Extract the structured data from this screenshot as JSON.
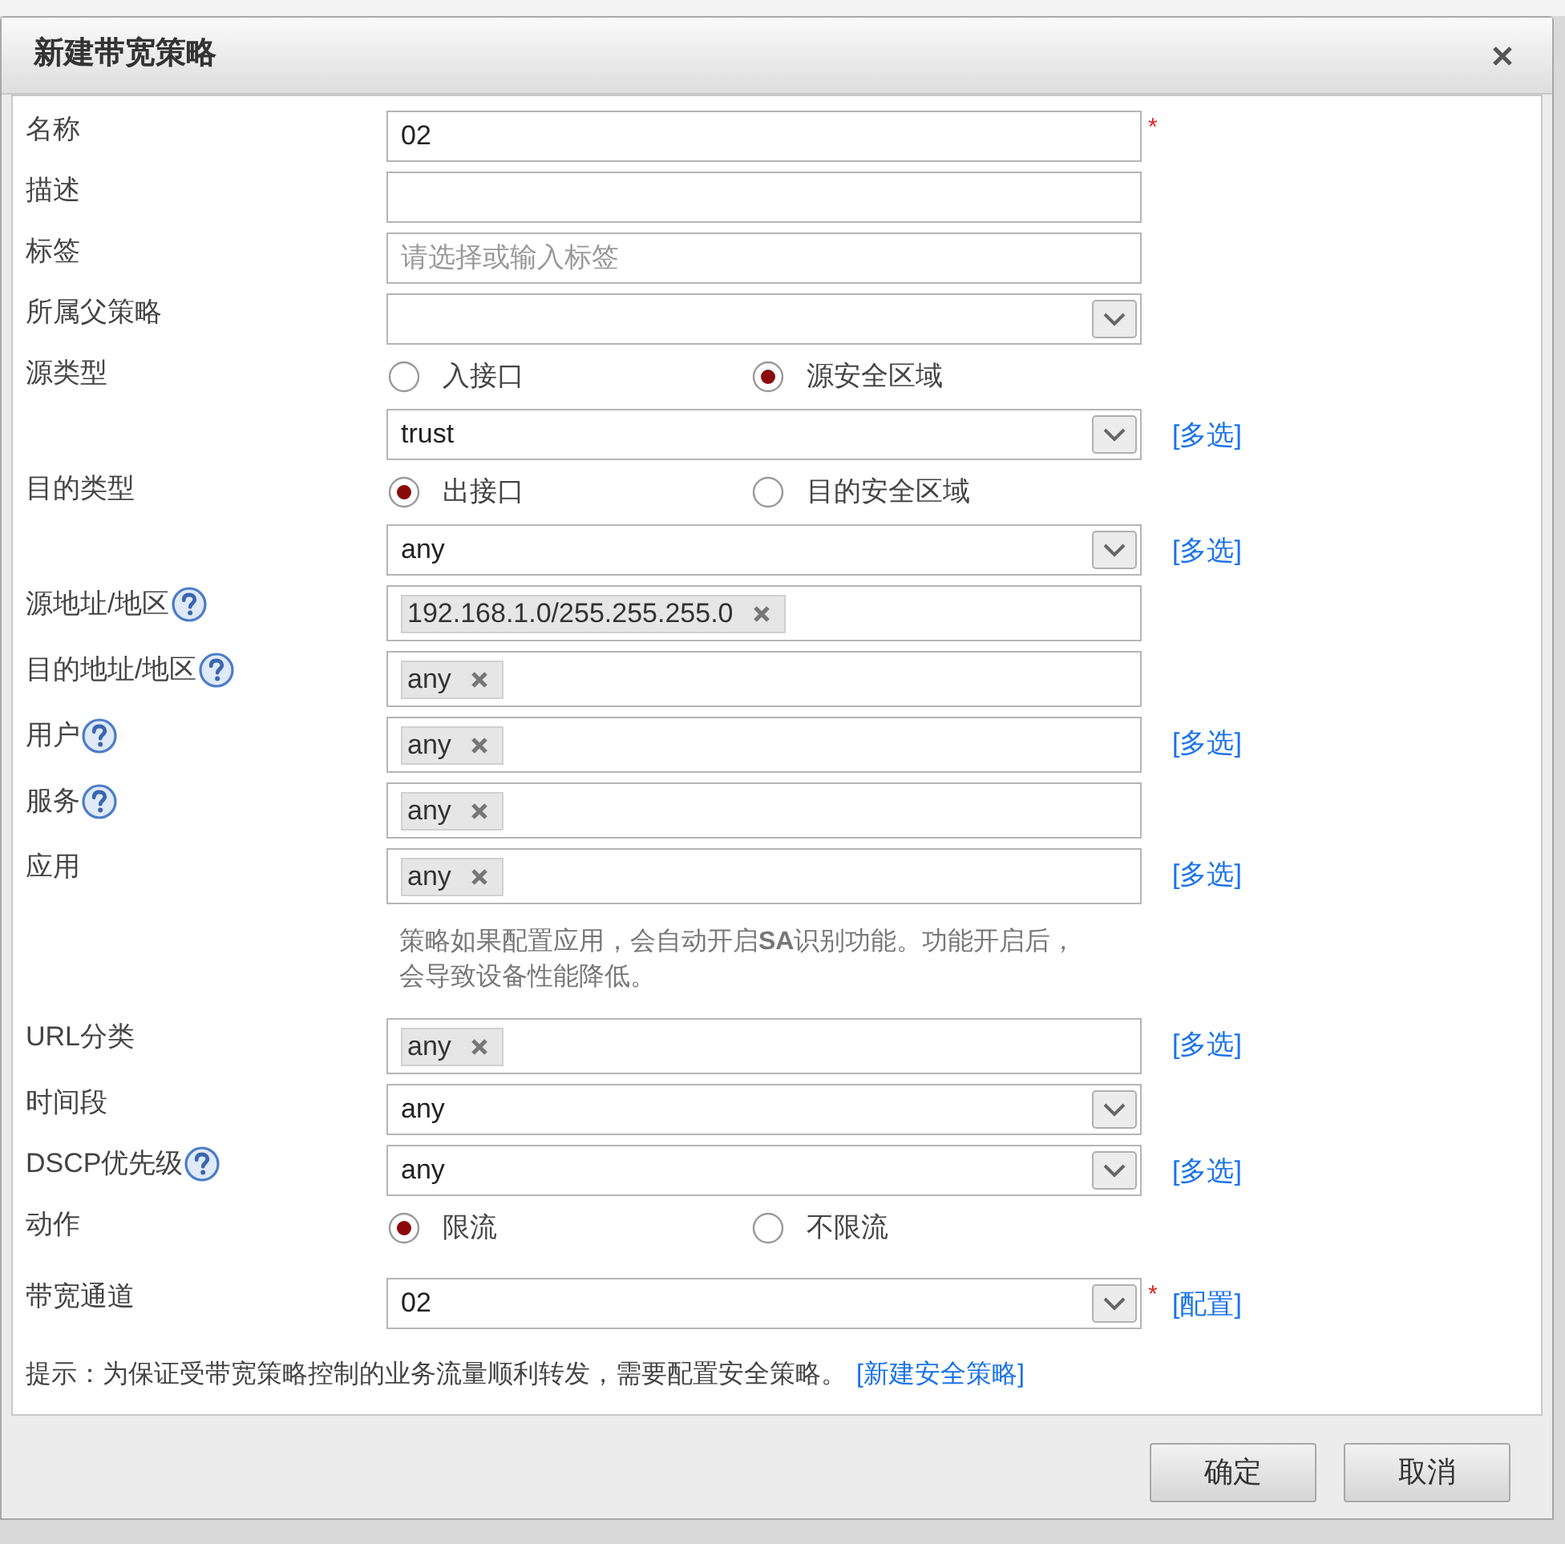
{
  "dialog": {
    "title": "新建带宽策略"
  },
  "fields": [
    {
      "kind": "text",
      "label": "名称",
      "value": "02",
      "required_mark": "*"
    },
    {
      "kind": "text",
      "label": "描述"
    },
    {
      "kind": "text",
      "label": "标签",
      "placeholder": "请选择或输入标签"
    },
    {
      "kind": "select",
      "label": "所属父策略"
    },
    {
      "kind": "radio",
      "label": "源类型",
      "options": [
        {
          "label": "入接口",
          "selected": false
        },
        {
          "label": "源安全区域",
          "selected": true
        }
      ]
    },
    {
      "kind": "select",
      "value": "trust",
      "link": "[多选]"
    },
    {
      "kind": "radio",
      "label": "目的类型",
      "options": [
        {
          "label": "出接口",
          "selected": true
        },
        {
          "label": "目的安全区域",
          "selected": false
        }
      ]
    },
    {
      "kind": "select",
      "value": "any",
      "link": "[多选]"
    },
    {
      "kind": "tags",
      "label": "源地址/地区",
      "help": true,
      "tags": [
        "192.168.1.0/255.255.255.0"
      ]
    },
    {
      "kind": "tags",
      "label": "目的地址/地区",
      "help": true,
      "tags": [
        "any"
      ]
    },
    {
      "kind": "tags",
      "label": "用户",
      "help": true,
      "tags": [
        "any"
      ],
      "link": "[多选]"
    },
    {
      "kind": "tags",
      "label": "服务",
      "help": true,
      "tags": [
        "any"
      ]
    },
    {
      "kind": "tags",
      "label": "应用",
      "tags": [
        "any"
      ],
      "link": "[多选]"
    },
    {
      "kind": "note",
      "text": "策略如果配置应用，会自动开启**SA**识别功能。功能开启后，会导致设备性能降低。"
    },
    {
      "kind": "tags",
      "label": "URL分类",
      "tags": [
        "any"
      ],
      "link": "[多选]"
    },
    {
      "kind": "select",
      "label": "时间段",
      "value": "any"
    },
    {
      "kind": "select",
      "label": "DSCP优先级",
      "help": true,
      "value": "any",
      "link": "[多选]"
    },
    {
      "kind": "radio",
      "label": "动作",
      "options": [
        {
          "label": "限流",
          "selected": true
        },
        {
          "label": "不限流",
          "selected": false
        }
      ]
    },
    {
      "kind": "select",
      "label": "带宽通道",
      "value": "02",
      "required_mark": "*",
      "link": "[配置]"
    }
  ],
  "hint": {
    "text": "提示：为保证受带宽策略控制的业务流量顺利转发，需要配置安全策略。",
    "link": "[新建安全策略]"
  },
  "buttons": [
    {
      "label": "确定"
    },
    {
      "label": "取消"
    }
  ]
}
